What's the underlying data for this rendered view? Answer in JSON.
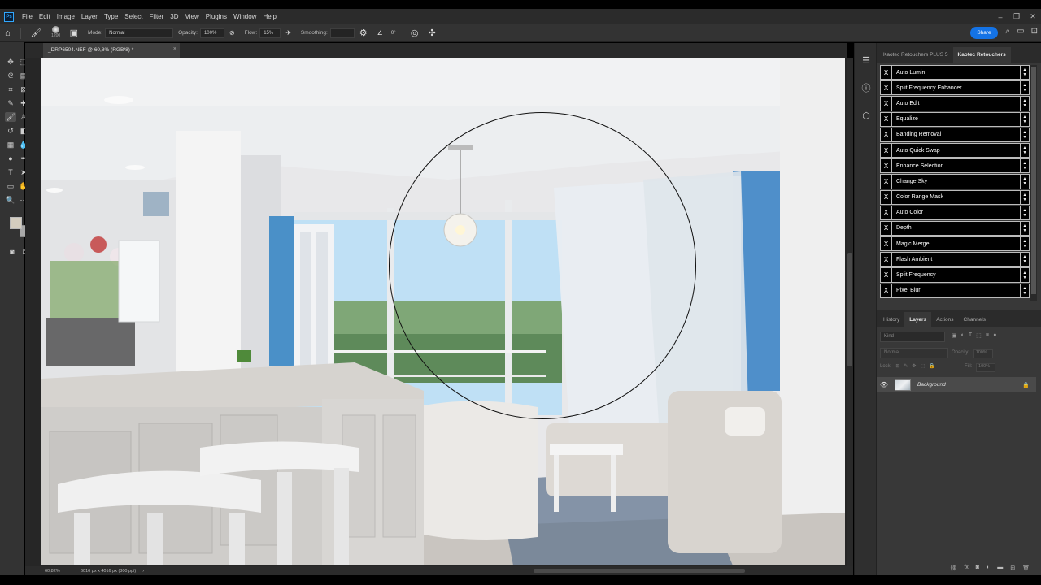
{
  "menubar": {
    "logo": "Ps",
    "items": [
      "File",
      "Edit",
      "Image",
      "Layer",
      "Type",
      "Select",
      "Filter",
      "3D",
      "View",
      "Plugins",
      "Window",
      "Help"
    ],
    "window_controls": [
      "–",
      "❐",
      "✕"
    ]
  },
  "options": {
    "brush_size": "1200",
    "mode_label": "Mode:",
    "mode_value": "Normal",
    "opacity_label": "Opacity:",
    "opacity_value": "100%",
    "flow_label": "Flow:",
    "flow_value": "15%",
    "smoothing_label": "Smoothing:",
    "smoothing_value": "",
    "angle_value": "0°",
    "share_label": "Share"
  },
  "document": {
    "tab_title": "_DRP6504.NEF @ 60,8% (RGB/8) *",
    "close": "×"
  },
  "status": {
    "zoom": "60,82%",
    "info": "6016 px x 4016 px (300 ppi)",
    "arrow": "›"
  },
  "right_panel": {
    "tabs": [
      "Kaotec Retouchers PLUS 5",
      "Kaotec Retouchers"
    ],
    "active_tab": 1,
    "kaotec_items": [
      "Auto Lumin",
      "Split Frequency Enhancer",
      "Auto Edit",
      "Equalize",
      "Banding Removal",
      "Auto Quick Swap",
      "Enhance Selection",
      "Change Sky",
      "Color Range Mask",
      "Auto Color",
      "Depth",
      "Magic Merge",
      "Flash Ambient",
      "Split Frequency",
      "Pixel Blur"
    ],
    "x_label": "X",
    "up_arrow": "▲",
    "down_arrow": "▼"
  },
  "layers_panel": {
    "tabs": [
      "History",
      "Layers",
      "Actions",
      "Channels"
    ],
    "active_tab": 1,
    "filter_placeholder": "Kind",
    "blend_mode": "Normal",
    "opacity_label": "Opacity:",
    "opacity_value": "100%",
    "lock_label": "Lock:",
    "fill_label": "Fill:",
    "fill_value": "100%",
    "layer_name": "Background"
  },
  "colors": {
    "foreground": "#d4cdbf",
    "background": "#a8a8a8",
    "accent": "#1473e6"
  }
}
